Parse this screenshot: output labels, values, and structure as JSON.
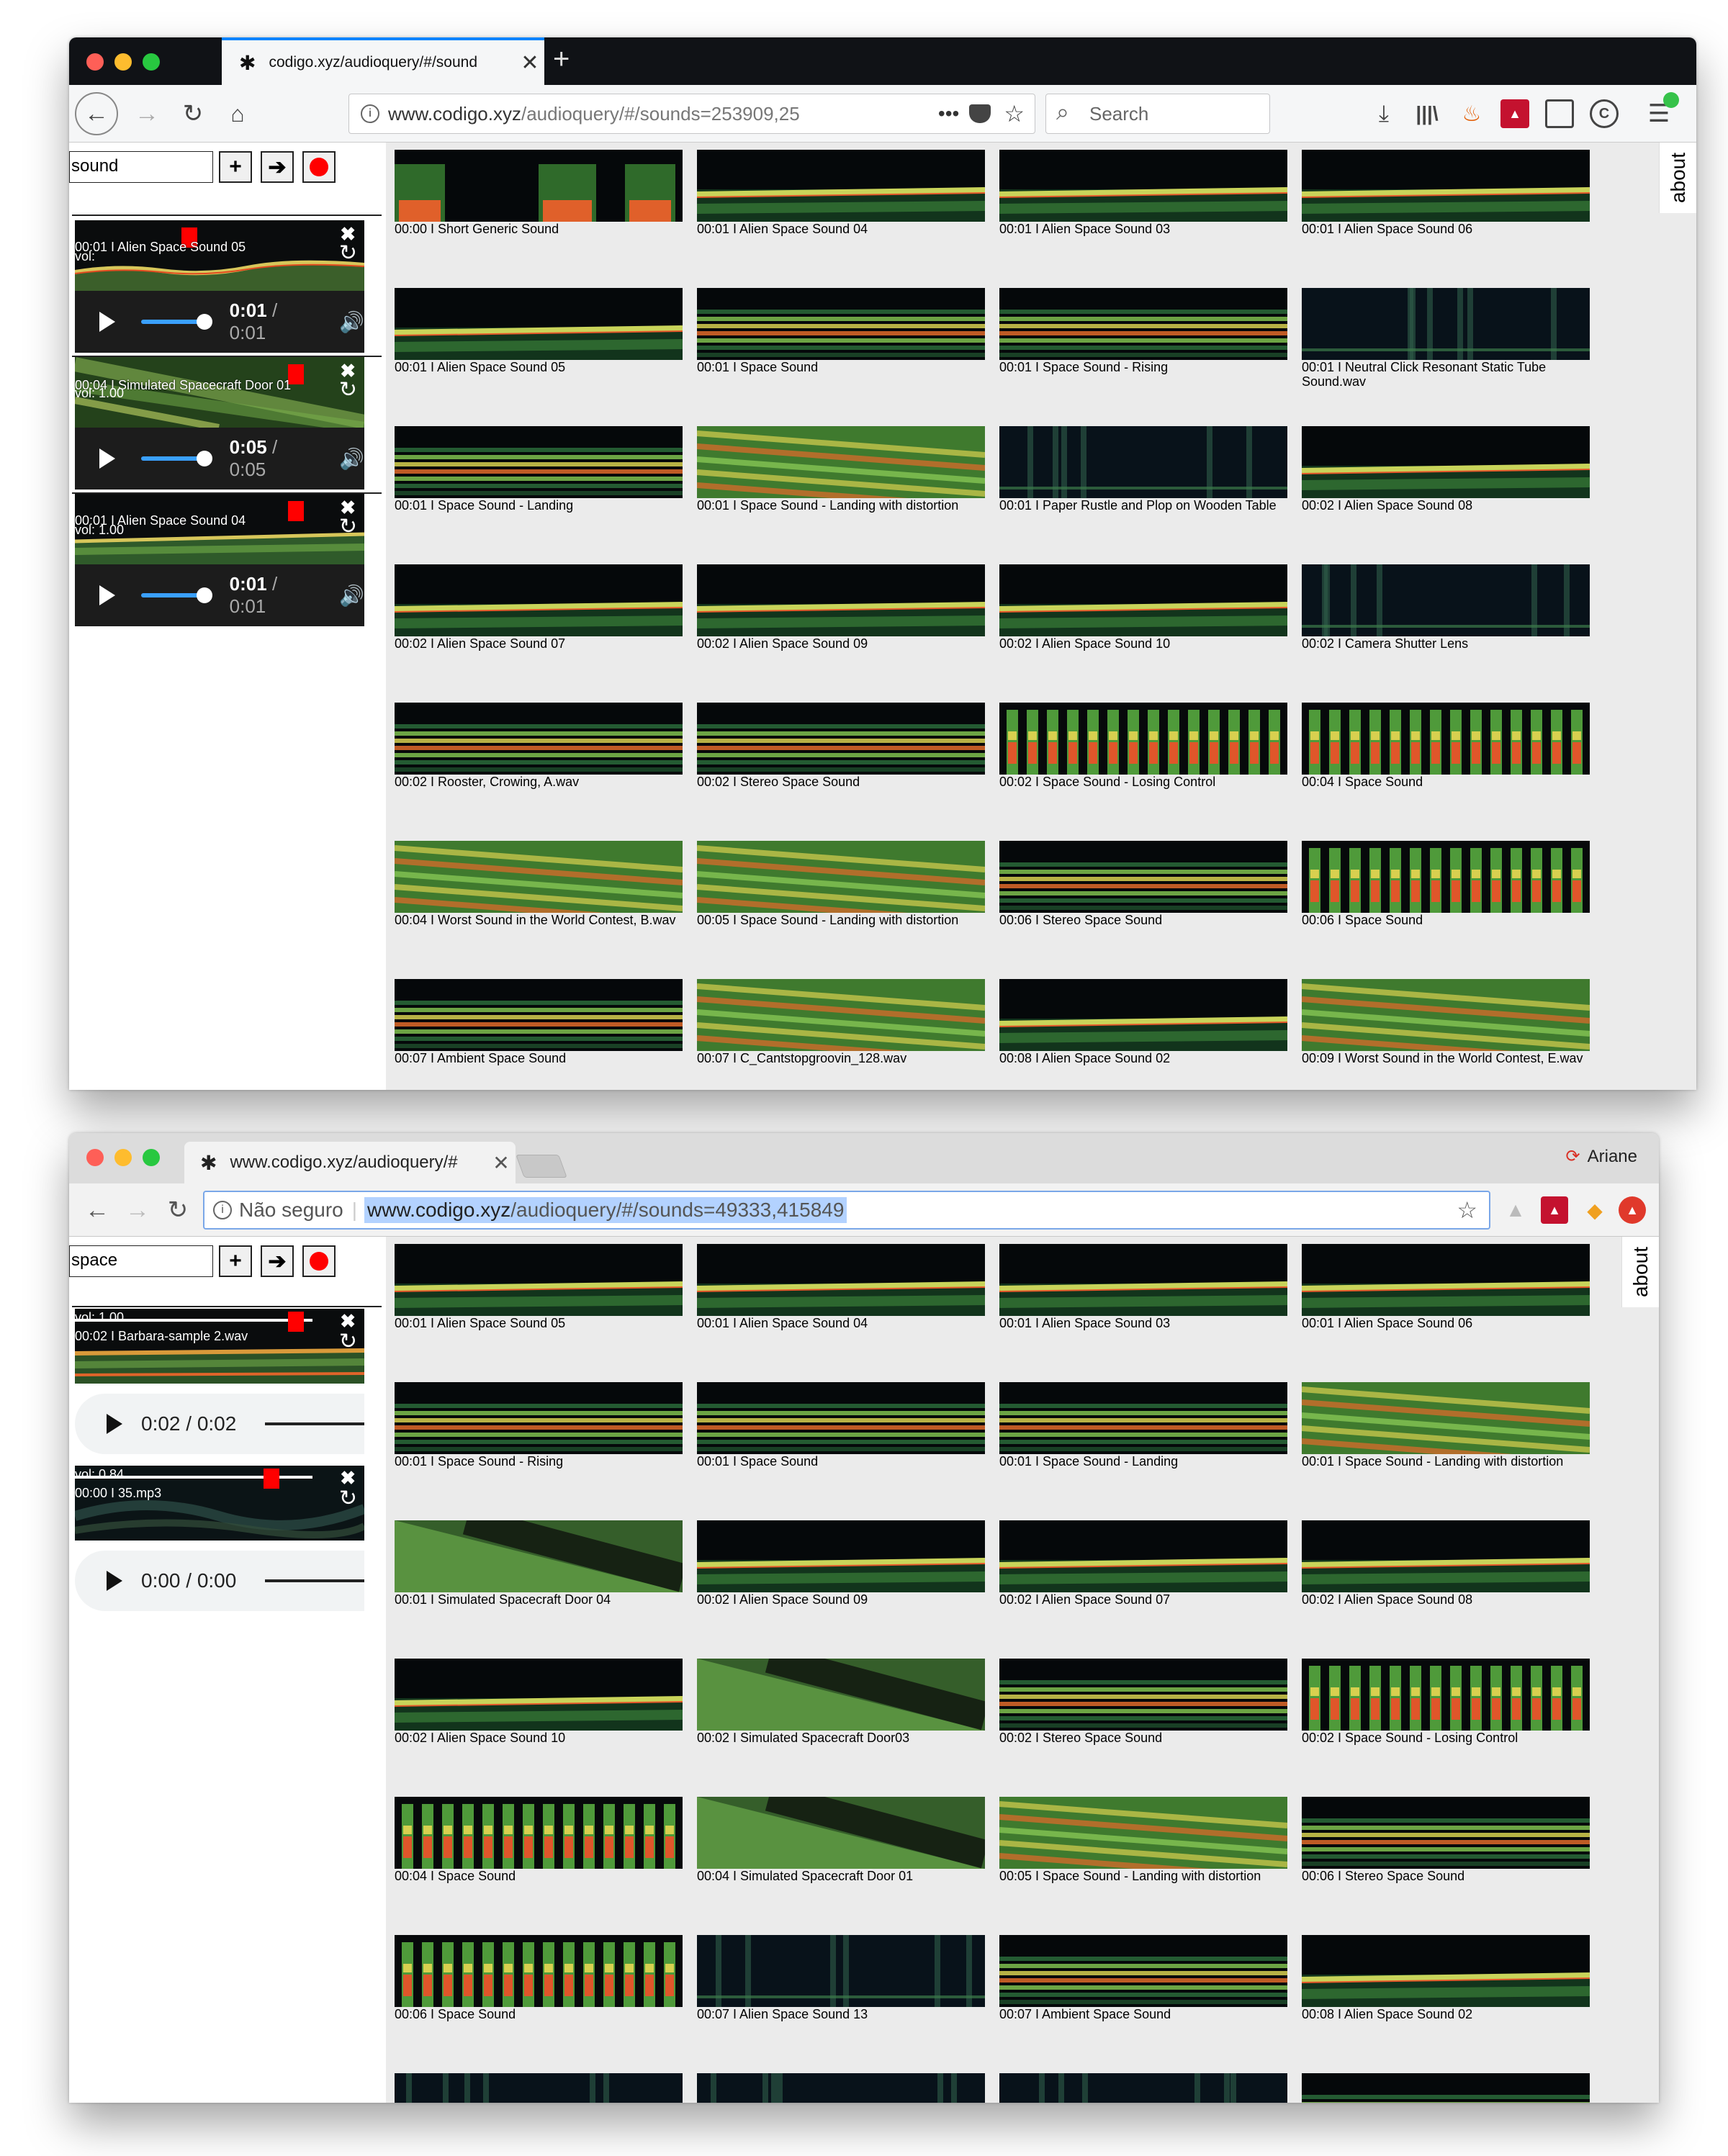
{
  "window1": {
    "tab_title": "codigo.xyz/audioquery/#/sound",
    "url_host": "www.codigo.xyz",
    "url_path": "/audioquery/#/sounds=253909,25",
    "search_placeholder": "Search",
    "query": "sound",
    "about_label": "about",
    "players": [
      {
        "label": "00:01 I Alien Space Sound 05",
        "vol": "vol:",
        "current": "0:01",
        "duration": "/ 0:01"
      },
      {
        "label": "00:04 I Simulated Spacecraft Door 01",
        "vol": "vol: 1.00",
        "current": "0:05",
        "duration": "/ 0:05"
      },
      {
        "label": "00:01 I Alien Space Sound 04",
        "vol": "vol: 1.00",
        "current": "0:01",
        "duration": "/ 0:01"
      }
    ],
    "tiles": [
      {
        "caption": "00:00 I Short Generic Sound",
        "style": "b"
      },
      {
        "caption": "00:01 I Alien Space Sound 04",
        "style": "a"
      },
      {
        "caption": "00:01 I Alien Space Sound 03",
        "style": "a"
      },
      {
        "caption": "00:01 I Alien Space Sound 06",
        "style": "a"
      },
      {
        "caption": "00:01 I Alien Space Sound 05",
        "style": "a"
      },
      {
        "caption": "00:01 I Space Sound",
        "style": "c"
      },
      {
        "caption": "00:01 I Space Sound - Rising",
        "style": "c"
      },
      {
        "caption": "00:01 I Neutral Click Resonant Static Tube Sound.wav",
        "style": "d"
      },
      {
        "caption": "00:01 I Space Sound - Landing",
        "style": "c"
      },
      {
        "caption": "00:01 I Space Sound - Landing with distortion",
        "style": "e"
      },
      {
        "caption": "00:01 I Paper Rustle and Plop on Wooden Table",
        "style": "d"
      },
      {
        "caption": "00:02 I Alien Space Sound 08",
        "style": "a"
      },
      {
        "caption": "00:02 I Alien Space Sound 07",
        "style": "a"
      },
      {
        "caption": "00:02 I Alien Space Sound 09",
        "style": "a"
      },
      {
        "caption": "00:02 I Alien Space Sound 10",
        "style": "a"
      },
      {
        "caption": "00:02 I Camera Shutter Lens",
        "style": "d"
      },
      {
        "caption": "00:02 I Rooster, Crowing, A.wav",
        "style": "c"
      },
      {
        "caption": "00:02 I Stereo Space Sound",
        "style": "c"
      },
      {
        "caption": "00:02 I Space Sound - Losing Control",
        "style": "f"
      },
      {
        "caption": "00:04 I Space Sound",
        "style": "f"
      },
      {
        "caption": "00:04 I Worst Sound in the World Contest, B.wav",
        "style": "e"
      },
      {
        "caption": "00:05 I Space Sound - Landing with distortion",
        "style": "e"
      },
      {
        "caption": "00:06 I Stereo Space Sound",
        "style": "c"
      },
      {
        "caption": "00:06 I Space Sound",
        "style": "f"
      },
      {
        "caption": "00:07 I Ambient Space Sound",
        "style": "c"
      },
      {
        "caption": "00:07 I C_Cantstopgroovin_128.wav",
        "style": "e"
      },
      {
        "caption": "00:08 I Alien Space Sound 02",
        "style": "a"
      },
      {
        "caption": "00:09 I Worst Sound in the World Contest, E.wav",
        "style": "e"
      }
    ]
  },
  "window2": {
    "tab_title": "www.codigo.xyz/audioquery/#",
    "user_name": "Ariane",
    "url_prefix": "Não seguro",
    "url_host": "www.codigo.xyz",
    "url_path": "/audioquery/#/sounds=49333,415849",
    "query": "space",
    "about_label": "about",
    "players": [
      {
        "vol": "vol: 1.00",
        "label": "00:02 I Barbara-sample 2.wav",
        "time": "0:02 / 0:02"
      },
      {
        "vol": "vol: 0.84",
        "label": "00:00 I 35.mp3",
        "time": "0:00 / 0:00"
      }
    ],
    "tiles": [
      {
        "caption": "00:01 I Alien Space Sound 05",
        "style": "a"
      },
      {
        "caption": "00:01 I Alien Space Sound 04",
        "style": "a"
      },
      {
        "caption": "00:01 I Alien Space Sound 03",
        "style": "a"
      },
      {
        "caption": "00:01 I Alien Space Sound 06",
        "style": "a"
      },
      {
        "caption": "00:01 I Space Sound - Rising",
        "style": "c"
      },
      {
        "caption": "00:01 I Space Sound",
        "style": "c"
      },
      {
        "caption": "00:01 I Space Sound - Landing",
        "style": "c"
      },
      {
        "caption": "00:01 I Space Sound - Landing with distortion",
        "style": "e"
      },
      {
        "caption": "00:01 I Simulated Spacecraft Door 04",
        "style": "g"
      },
      {
        "caption": "00:02 I Alien Space Sound 09",
        "style": "a"
      },
      {
        "caption": "00:02 I Alien Space Sound 07",
        "style": "a"
      },
      {
        "caption": "00:02 I Alien Space Sound 08",
        "style": "a"
      },
      {
        "caption": "00:02 I Alien Space Sound 10",
        "style": "a"
      },
      {
        "caption": "00:02 I Simulated Spacecraft Door03",
        "style": "g"
      },
      {
        "caption": "00:02 I Stereo Space Sound",
        "style": "c"
      },
      {
        "caption": "00:02 I Space Sound - Losing Control",
        "style": "f"
      },
      {
        "caption": "00:04 I Space Sound",
        "style": "f"
      },
      {
        "caption": "00:04 I Simulated Spacecraft Door 01",
        "style": "g"
      },
      {
        "caption": "00:05 I Space Sound - Landing with distortion",
        "style": "e"
      },
      {
        "caption": "00:06 I Stereo Space Sound",
        "style": "c"
      },
      {
        "caption": "00:06 I Space Sound",
        "style": "f"
      },
      {
        "caption": "00:07 I Alien Space Sound 13",
        "style": "d"
      },
      {
        "caption": "00:07 I Ambient Space Sound",
        "style": "c"
      },
      {
        "caption": "00:08 I Alien Space Sound 02",
        "style": "a"
      },
      {
        "caption": "",
        "style": "d"
      },
      {
        "caption": "",
        "style": "d"
      },
      {
        "caption": "",
        "style": "d"
      },
      {
        "caption": "",
        "style": "c"
      }
    ]
  }
}
